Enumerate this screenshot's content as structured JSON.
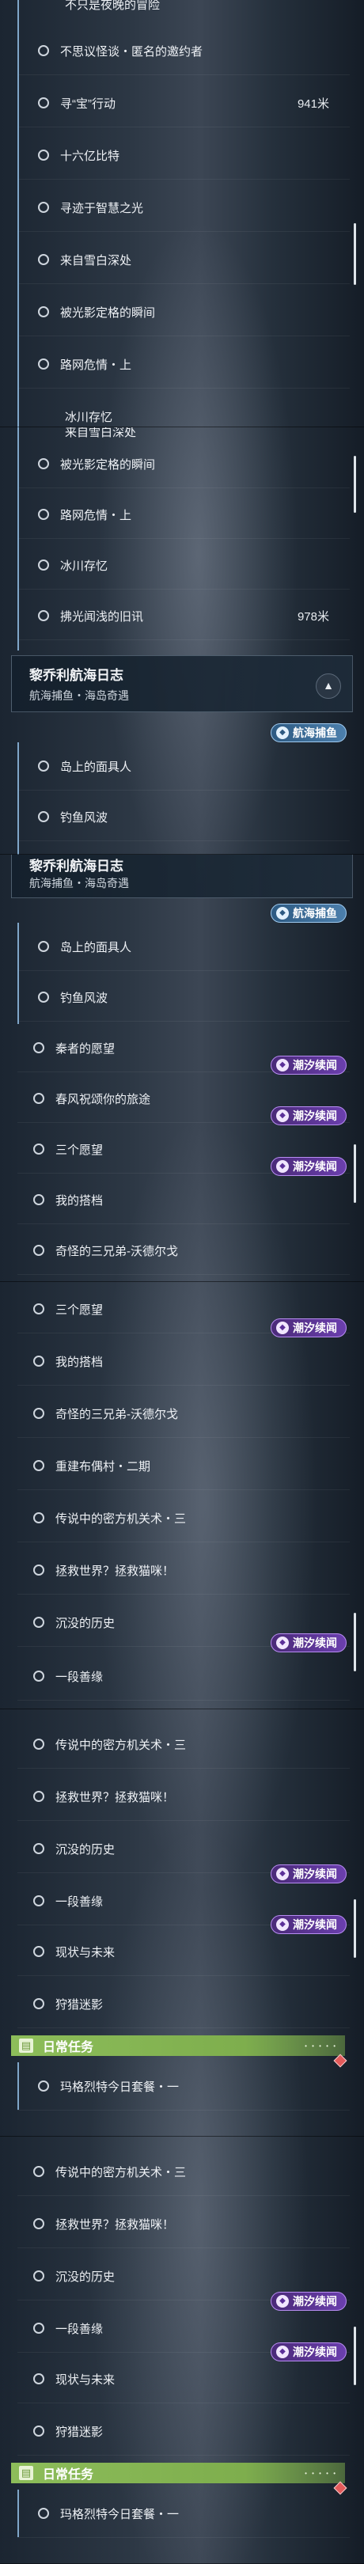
{
  "s1": {
    "partial_top": "不只是夜晚的冒险",
    "rows": [
      {
        "label": "不思议怪谈・匿名的邀约者"
      },
      {
        "label": "寻“宝”行动",
        "distance": "941米"
      },
      {
        "label": "十六亿比特"
      },
      {
        "label": "寻迹于智慧之光"
      },
      {
        "label": "来自雪白深处"
      },
      {
        "label": "被光影定格的瞬间"
      },
      {
        "label": "路网危情・上"
      }
    ],
    "partial_bottom": "冰川存忆"
  },
  "s2": {
    "partial_top": "来自雪白深处",
    "rows": [
      {
        "label": "被光影定格的瞬间"
      },
      {
        "label": "路网危情・上"
      },
      {
        "label": "冰川存忆"
      },
      {
        "label": "拂光闻浅的旧讯",
        "distance": "978米"
      }
    ],
    "group": {
      "title": "黎乔利航海日志",
      "subtitle": "航海捕鱼・海岛奇遇"
    },
    "tag_ice": "航海捕鱼",
    "rows2": [
      {
        "label": "岛上的面具人"
      },
      {
        "label": "钓鱼风波"
      }
    ]
  },
  "s3": {
    "group": {
      "title": "黎乔利航海日志",
      "subtitle": "航海捕鱼・海岛奇遇"
    },
    "tag_ice": "航海捕鱼",
    "tag_tide": "潮汐续闻",
    "rows": [
      {
        "label": "岛上的面具人"
      },
      {
        "label": "钓鱼风波"
      },
      {
        "label": "秦者的愿望"
      },
      {
        "label": "春风祝颂你的旅途"
      },
      {
        "label": "三个愿望"
      },
      {
        "label": "我的搭档"
      },
      {
        "label": "奇怪的三兄弟-沃德尔戈"
      }
    ]
  },
  "s4": {
    "tag_tide": "潮汐续闻",
    "rows": [
      {
        "label": "三个愿望"
      },
      {
        "label": "我的搭档"
      },
      {
        "label": "奇怪的三兄弟-沃德尔戈"
      },
      {
        "label": "重建布偶村・二期"
      },
      {
        "label": "传说中的密方机关术・三"
      },
      {
        "label": "拯救世界？拯救猫咪！"
      },
      {
        "label": "沉没的历史"
      },
      {
        "label": "一段善缘"
      }
    ]
  },
  "s5": {
    "tag_tide": "潮汐续闻",
    "rows": [
      {
        "label": "传说中的密方机关术・三"
      },
      {
        "label": "拯救世界？拯救猫咪！"
      },
      {
        "label": "沉没的历史"
      },
      {
        "label": "一段善缘"
      },
      {
        "label": "现状与未来"
      },
      {
        "label": "狩猎迷影"
      }
    ],
    "daily": "日常任务",
    "daily_row": "玛格烈特今日套餐・一"
  },
  "s6": {
    "tag_tide": "潮汐续闻",
    "rows": [
      {
        "label": "传说中的密方机关术・三"
      },
      {
        "label": "拯救世界？拯救猫咪！"
      },
      {
        "label": "沉没的历史"
      },
      {
        "label": "一段善缘"
      },
      {
        "label": "现状与未来"
      },
      {
        "label": "狩猎迷影"
      }
    ],
    "daily": "日常任务",
    "daily_row": "玛格烈特今日套餐・一"
  },
  "icons": {
    "circle": "circle-icon",
    "tag": "quest-tag-icon",
    "daily": "book-icon",
    "chevron": "chevron-up-icon",
    "marker": "diamond-marker-icon"
  },
  "colors": {
    "tide_tag": "#6b3fae",
    "ice_tag": "#4c7fac",
    "daily_bar": "#8dbd5a",
    "active_line": "#7fa6c9"
  }
}
